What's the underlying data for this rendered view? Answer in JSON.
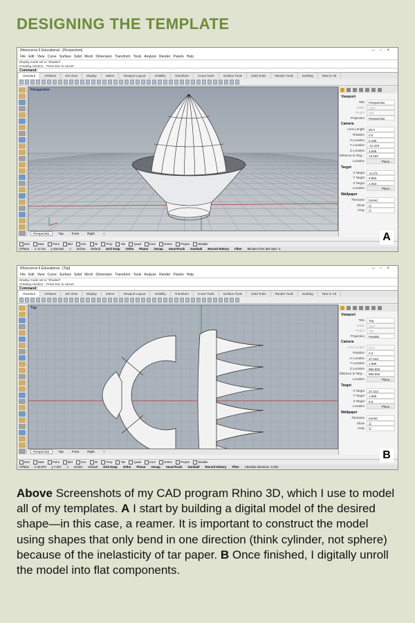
{
  "title": "DESIGNING THE TEMPLATE",
  "caption": {
    "lead": "Above",
    "text_1": " Screenshots of my CAD program Rhino 3D, which I use to model all of my templates. ",
    "label_a": "A",
    "text_2": " I start by building a digital model of the desired shape—in this case, a reamer. It is important to construct the model using shapes that only bend in one direction (think cylinder, not sphere) because of the inelasticity of tar paper. ",
    "label_b": "B",
    "text_3": " Once finished, I digitally unroll the model into flat components."
  },
  "app": {
    "menu": [
      "File",
      "Edit",
      "View",
      "Curve",
      "Surface",
      "Solid",
      "Mesh",
      "Dimension",
      "Transform",
      "Tools",
      "Analyze",
      "Render",
      "Panels",
      "Help"
    ],
    "cmd_history_1": "Display mode set to \"Shaded\".",
    "cmd_history_2": "Creating meshes... Press Esc to cancel",
    "command_label": "Command:",
    "toolbar_tabs": [
      "Standard",
      "CPlanes",
      "Set View",
      "Display",
      "Select",
      "Viewport Layout",
      "Visibility",
      "Transform",
      "Curve Tools",
      "Surface Tools",
      "Solid Tools",
      "Render Tools",
      "Drafting",
      "New in V6"
    ],
    "view_tabs": [
      "Perspective",
      "Top",
      "Front",
      "Right"
    ],
    "add_view": "+",
    "osnaps": [
      "End",
      "Near",
      "Point",
      "Mid",
      "Cen",
      "Int",
      "Perp",
      "Tan",
      "Quad",
      "Knot",
      "Vertex",
      "Project",
      "Disable"
    ],
    "status_items": [
      "Grid Snap",
      "Ortho",
      "Planar",
      "Osnap",
      "SmartTrack",
      "Gumball",
      "Record History",
      "Filter"
    ],
    "panel": {
      "viewport_header": "Viewport",
      "camera_header": "Camera",
      "target_header": "Target",
      "wallpaper_header": "Wallpaper",
      "place_button": "Place..."
    }
  },
  "screenshot_a": {
    "window_title": "Rhinoceros 6 Educational - [Perspective]",
    "viewport_label": "Perspective",
    "badge": "A",
    "viewport_props": [
      {
        "k": "Title",
        "v": "Perspective"
      },
      {
        "k": "Width",
        "v": "1537",
        "grey": true
      },
      {
        "k": "Height",
        "v": "756",
        "grey": true
      },
      {
        "k": "Projection",
        "v": "Perspective"
      }
    ],
    "camera_props": [
      {
        "k": "Lens Length",
        "v": "50.0"
      },
      {
        "k": "Rotation",
        "v": "0.0"
      },
      {
        "k": "X Location",
        "v": "0.106"
      },
      {
        "k": "Y Location",
        "v": "-12.434"
      },
      {
        "k": "Z Location",
        "v": "4.509"
      },
      {
        "k": "Distance to Targ...",
        "v": "13.033"
      },
      {
        "k": "Location",
        "v": "Place...",
        "btn": true
      }
    ],
    "target_props": [
      {
        "k": "X Target",
        "v": "-0.174"
      },
      {
        "k": "Y Target",
        "v": "0.963"
      },
      {
        "k": "Z Target",
        "v": "1.044"
      },
      {
        "k": "Location",
        "v": "Place...",
        "btn": true
      }
    ],
    "wallpaper_props": [
      {
        "k": "Filename",
        "v": "(none)"
      },
      {
        "k": "Show",
        "v": "☑",
        "chk": true
      },
      {
        "k": "Gray",
        "v": "☑",
        "chk": true
      }
    ],
    "status_cplane": "CPlane",
    "status_x": "x -3.714",
    "status_y": "y 202.921",
    "status_z": "z",
    "status_units": "Inches",
    "status_layer": "Default",
    "status_tail": "Minutes from last save: 3"
  },
  "screenshot_b": {
    "window_title": "Rhinoceros 6 Educational - [Top]",
    "viewport_label": "Top",
    "badge": "B",
    "viewport_props": [
      {
        "k": "Title",
        "v": "Top"
      },
      {
        "k": "Width",
        "v": "1537",
        "grey": true
      },
      {
        "k": "Height",
        "v": "756",
        "grey": true
      },
      {
        "k": "Projection",
        "v": "Parallel"
      }
    ],
    "camera_props": [
      {
        "k": "Lens Length",
        "v": "50.0",
        "grey": true
      },
      {
        "k": "Rotation",
        "v": "0.0"
      },
      {
        "k": "X Location",
        "v": "27.413"
      },
      {
        "k": "Y Location",
        "v": "1.969"
      },
      {
        "k": "Z Location",
        "v": "882.502"
      },
      {
        "k": "Distance to Targ...",
        "v": "882.502"
      },
      {
        "k": "Location",
        "v": "Place...",
        "btn": true
      }
    ],
    "target_props": [
      {
        "k": "X Target",
        "v": "27.413"
      },
      {
        "k": "Y Target",
        "v": "1.969"
      },
      {
        "k": "Z Target",
        "v": "0.0"
      },
      {
        "k": "Location",
        "v": "Place...",
        "btn": true
      }
    ],
    "wallpaper_props": [
      {
        "k": "Filename",
        "v": "(none)"
      },
      {
        "k": "Show",
        "v": "☑",
        "chk": true
      },
      {
        "k": "Gray",
        "v": "☑",
        "chk": true
      }
    ],
    "status_cplane": "CPlane",
    "status_x": "x 34.879",
    "status_y": "y 7.347",
    "status_z": "z",
    "status_units": "Inches",
    "status_layer": "Default",
    "status_tail": "Absolute tolerance: 0.001"
  }
}
